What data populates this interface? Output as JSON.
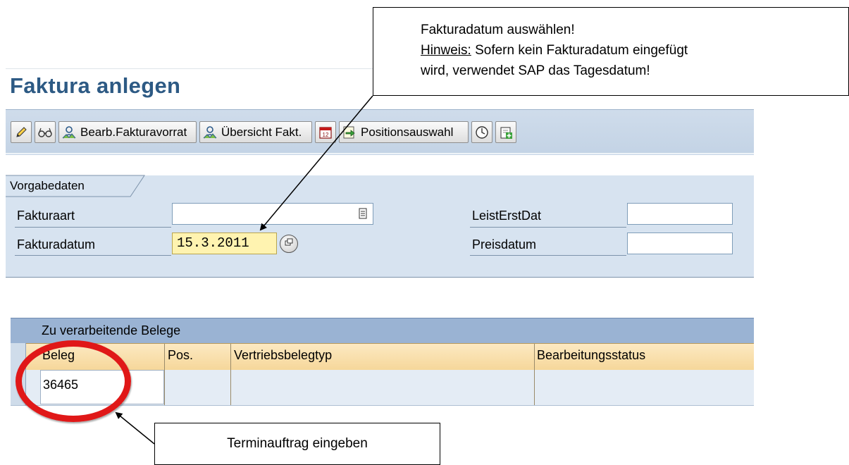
{
  "page": {
    "title": "Faktura anlegen"
  },
  "toolbar": {
    "buttons": [
      {
        "icon": "pencil-icon",
        "label": ""
      },
      {
        "icon": "glasses-icon",
        "label": ""
      },
      {
        "icon": "worklist-icon",
        "label": "Bearb.Fakturavorrat"
      },
      {
        "icon": "worklist-icon",
        "label": "Übersicht Fakt."
      },
      {
        "icon": "calendar-icon",
        "label": ""
      },
      {
        "icon": "selection-icon",
        "label": "Positionsauswahl"
      },
      {
        "icon": "clock-icon",
        "label": ""
      },
      {
        "icon": "add-document-icon",
        "label": ""
      }
    ]
  },
  "defaults_section": {
    "tab_label": "Vorgabedaten",
    "fakturaart": {
      "label": "Fakturaart",
      "value": ""
    },
    "fakturadatum": {
      "label": "Fakturadatum",
      "value": "15.3.2011"
    },
    "leisterstdat": {
      "label": "LeistErstDat",
      "value": ""
    },
    "preisdatum": {
      "label": "Preisdatum",
      "value": ""
    }
  },
  "documents_table": {
    "title": "Zu verarbeitende Belege",
    "columns": [
      "Beleg",
      "Pos.",
      "Vertriebsbelegtyp",
      "Bearbeitungsstatus"
    ],
    "rows": [
      {
        "beleg": "36465",
        "pos": "",
        "vertriebsbelegtyp": "",
        "bearbeitungsstatus": ""
      }
    ]
  },
  "annotations": {
    "top_callout": {
      "line1": "Fakturadatum auswählen!",
      "hint_prefix": "Hinweis:",
      "hint_rest": " Sofern kein Fakturadatum eingefügt",
      "line3": "wird, verwendet SAP das Tagesdatum!"
    },
    "bottom_callout": {
      "text": "Terminauftrag eingeben"
    },
    "highlight_color": "#e01818"
  }
}
